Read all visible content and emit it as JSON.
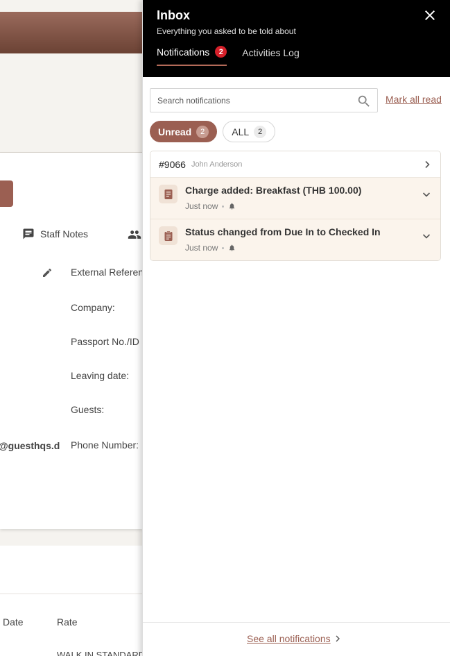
{
  "background": {
    "tab_staff_notes": "Staff Notes",
    "fields": [
      "External Reference",
      "Company:",
      "Passport No./ID",
      "Leaving date:",
      "Guests:",
      "Phone Number:"
    ],
    "email_fragment": "@guesthqs.d",
    "table_headers": [
      "Date",
      "Rate"
    ],
    "table_row": "WALK IN STANDARD"
  },
  "inbox": {
    "title": "Inbox",
    "subtitle": "Everything you asked to be told about",
    "tabs": [
      {
        "label": "Notifications",
        "badge": "2"
      },
      {
        "label": "Activities Log"
      }
    ],
    "search_placeholder": "Search notifications",
    "mark_all_read": "Mark all read",
    "filters": [
      {
        "label": "Unread",
        "count": "2"
      },
      {
        "label": "ALL",
        "count": "2"
      }
    ],
    "group": {
      "id": "#9066",
      "name": "John Anderson",
      "items": [
        {
          "title": "Charge added: Breakfast (THB 100.00)",
          "time": "Just now",
          "icon": "receipt-icon"
        },
        {
          "title": "Status changed from Due In to Checked In",
          "time": "Just now",
          "icon": "clipboard-icon"
        }
      ]
    },
    "see_all": "See all notifications"
  },
  "colors": {
    "accent": "#9b5f52",
    "header_bg": "#000000",
    "badge_red": "#d6202a",
    "notification_bg": "#fbf4ec"
  }
}
